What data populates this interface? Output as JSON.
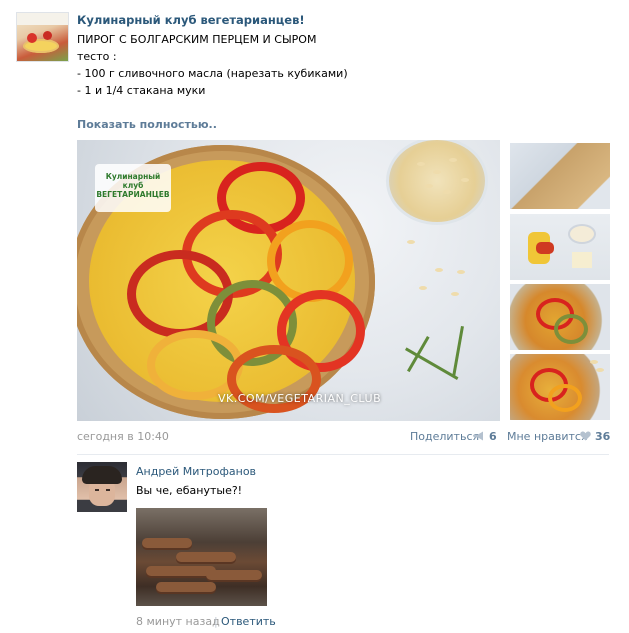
{
  "post": {
    "group_name": "Кулинарный клуб вегетарианцев!",
    "lines": [
      "ПИРОГ С БОЛГАРСКИМ ПЕРЦЕМ И СЫРОМ",
      "",
      "тесто :",
      "- 100 г сливочного масла (нарезать кубиками)",
      "- 1 и 1/4 стакана муки"
    ],
    "show_more": "Показать полностью..",
    "photo_logo_text": "Кулинарный клуб ВЕГЕТАРИАНЦЕВ",
    "photo_watermark": "VK.COM/VEGETARIAN_CLUB",
    "date": "сегодня в 10:40",
    "share_label": "Поделиться",
    "share_count": "6",
    "like_label": "Мне нравится",
    "like_count": "36"
  },
  "comment": {
    "author": "Андрей Митрофанов",
    "text": "Вы че, ебанутые?!",
    "time": "8 минут назад",
    "separator": "|",
    "reply_label": "Ответить"
  },
  "colors": {
    "link": "#2b587a",
    "muted_link": "#5e7c98",
    "meta_gray": "#999999",
    "icon_gray": "#b4c1cf"
  },
  "icons": {
    "share": "megaphone-icon",
    "like": "heart-icon"
  }
}
